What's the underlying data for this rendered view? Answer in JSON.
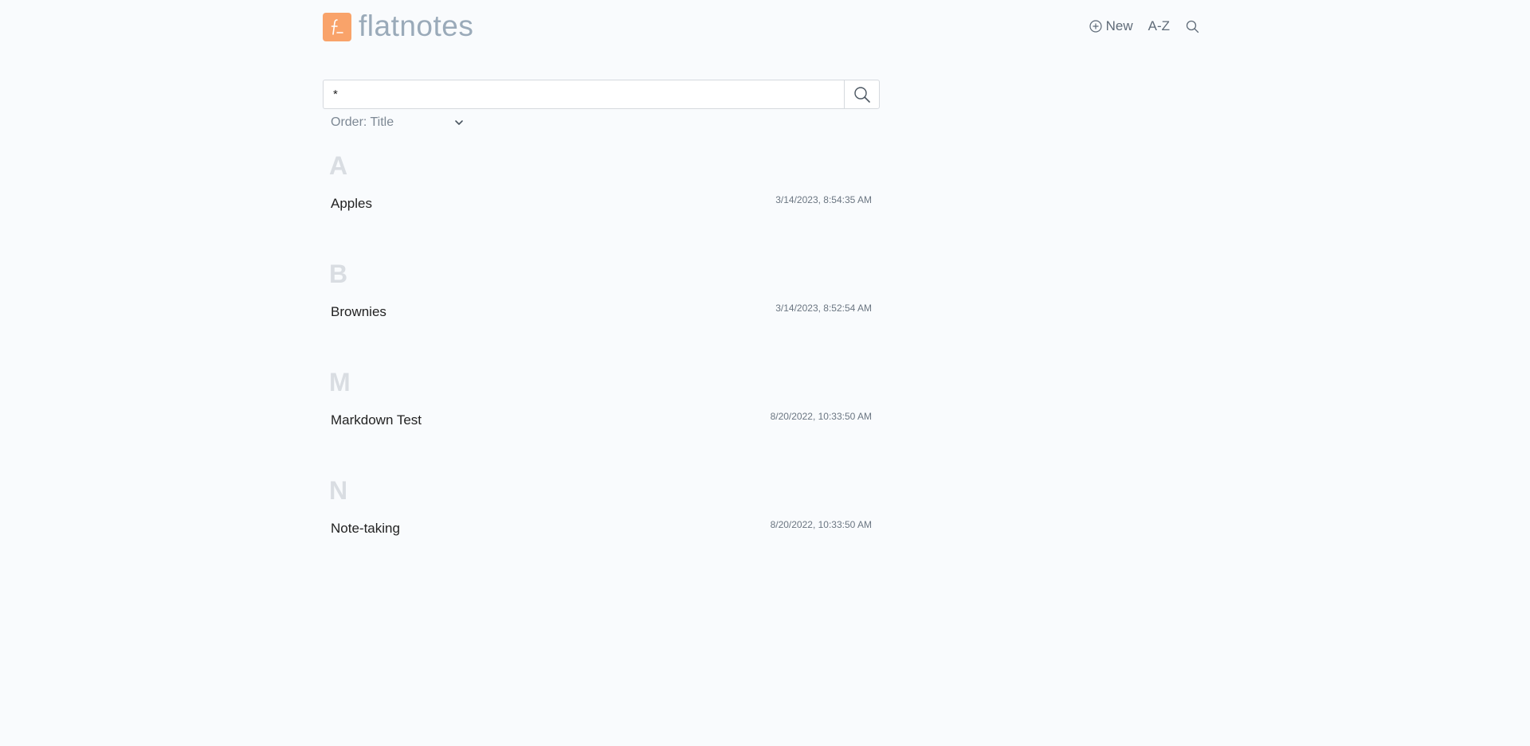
{
  "app": {
    "name": "flatnotes",
    "logo_glyph": "f_",
    "brand_color": "#f9a36a"
  },
  "nav": {
    "new_label": "New",
    "az_label": "A-Z",
    "icons": [
      "plus-circle-icon",
      "search-icon"
    ]
  },
  "search": {
    "value": "*",
    "placeholder": ""
  },
  "sort": {
    "label": "Order: Title"
  },
  "groups": [
    {
      "letter": "A",
      "notes": [
        {
          "title": "Apples",
          "modified": "3/14/2023, 8:54:35 AM"
        }
      ]
    },
    {
      "letter": "B",
      "notes": [
        {
          "title": "Brownies",
          "modified": "3/14/2023, 8:52:54 AM"
        }
      ]
    },
    {
      "letter": "M",
      "notes": [
        {
          "title": "Markdown Test",
          "modified": "8/20/2022, 10:33:50 AM"
        }
      ]
    },
    {
      "letter": "N",
      "notes": [
        {
          "title": "Note-taking",
          "modified": "8/20/2022, 10:33:50 AM"
        }
      ]
    }
  ]
}
